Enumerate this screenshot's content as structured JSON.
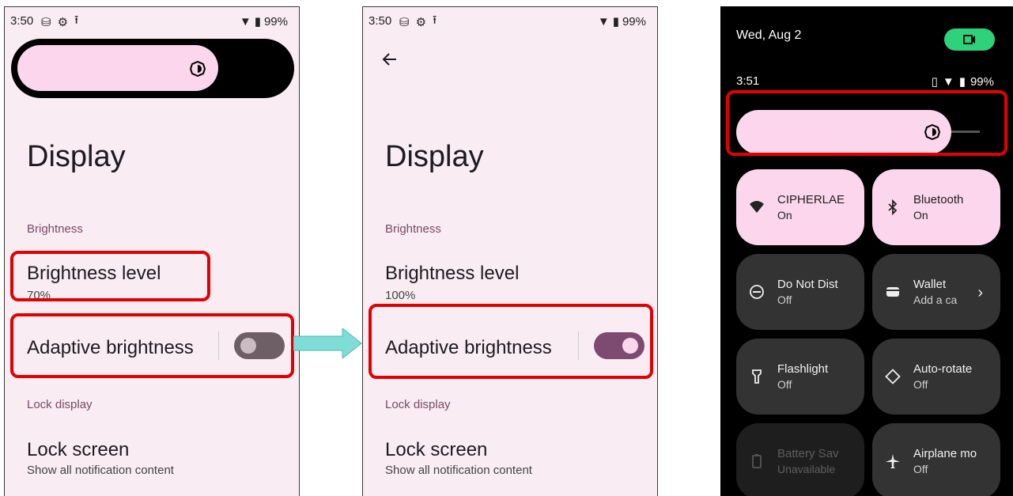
{
  "left_screen": {
    "status": {
      "time": "3:50",
      "battery": "99%"
    },
    "title": "Display",
    "section_brightness": "Brightness",
    "brightness_level_label": "Brightness level",
    "brightness_level_value": "70%",
    "adaptive_label": "Adaptive brightness",
    "adaptive_on": false,
    "section_lock": "Lock display",
    "lock_screen_label": "Lock screen",
    "lock_screen_sub": "Show all notification content"
  },
  "right_screen": {
    "status": {
      "time": "3:50",
      "battery": "99%"
    },
    "title": "Display",
    "section_brightness": "Brightness",
    "brightness_level_label": "Brightness level",
    "brightness_level_value": "100%",
    "adaptive_label": "Adaptive brightness",
    "adaptive_on": true,
    "section_lock": "Lock display",
    "lock_screen_label": "Lock screen",
    "lock_screen_sub": "Show all notification content"
  },
  "quick_settings": {
    "date": "Wed, Aug 2",
    "time": "3:51",
    "battery": "99%",
    "tiles": [
      {
        "label": "CIPHERLAE",
        "state": "On",
        "icon": "wifi-icon"
      },
      {
        "label": "Bluetooth",
        "state": "On",
        "icon": "bluetooth-icon"
      },
      {
        "label": "Do Not Dist",
        "state": "Off",
        "icon": "do-not-disturb-icon"
      },
      {
        "label": "Wallet",
        "state": "Add a ca",
        "icon": "wallet-icon"
      },
      {
        "label": "Flashlight",
        "state": "Off",
        "icon": "flashlight-icon"
      },
      {
        "label": "Auto-rotate",
        "state": "Off",
        "icon": "auto-rotate-icon"
      },
      {
        "label": "Battery Sav",
        "state": "Unavailable",
        "icon": "battery-saver-icon"
      },
      {
        "label": "Airplane mo",
        "state": "Off",
        "icon": "airplane-icon"
      }
    ]
  },
  "colors": {
    "accent": "#7d4a72",
    "tile_on": "#fbd6ec",
    "highlight": "#e00000",
    "arrow": "#7fdcd6"
  }
}
